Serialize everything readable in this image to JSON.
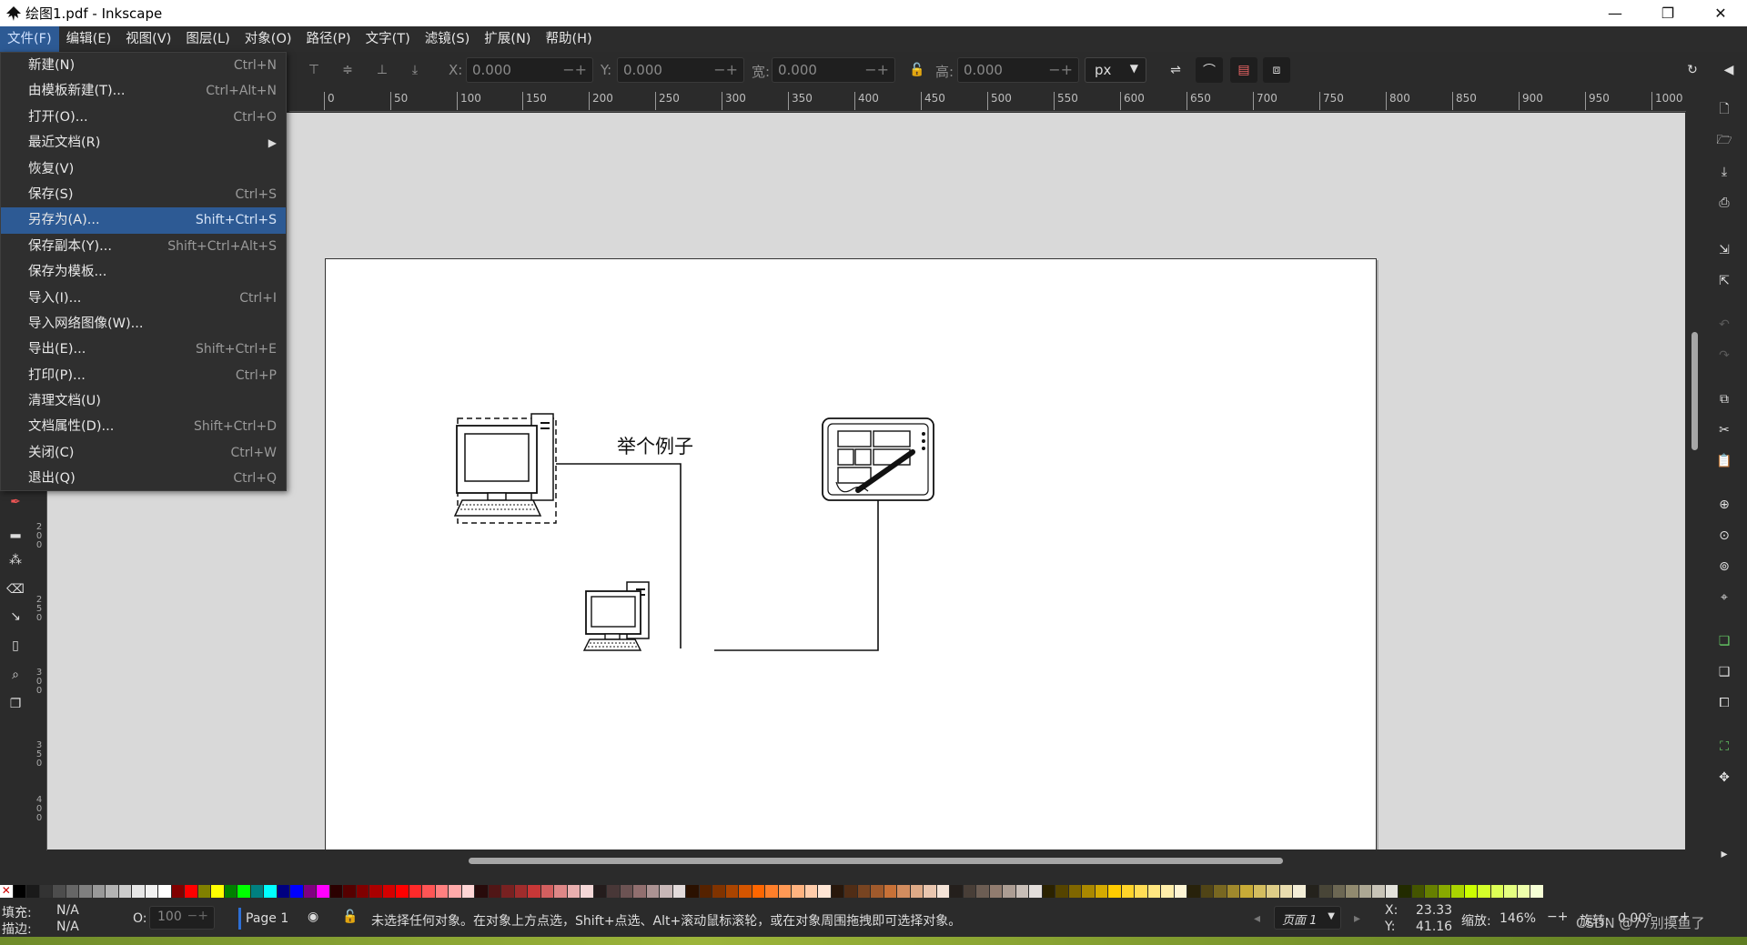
{
  "window": {
    "title": "绘图1.pdf - Inkscape",
    "minimize": "—",
    "maximize": "❐",
    "close": "✕"
  },
  "menubar": [
    "文件(F)",
    "编辑(E)",
    "视图(V)",
    "图层(L)",
    "对象(O)",
    "路径(P)",
    "文字(T)",
    "滤镜(S)",
    "扩展(N)",
    "帮助(H)"
  ],
  "file_menu": [
    {
      "label": "新建(N)",
      "shortcut": "Ctrl+N"
    },
    {
      "label": "由模板新建(T)...",
      "shortcut": "Ctrl+Alt+N"
    },
    {
      "label": "打开(O)...",
      "shortcut": "Ctrl+O"
    },
    {
      "label": "最近文档(R)",
      "shortcut": ""
    },
    {
      "label": "恢复(V)",
      "shortcut": ""
    },
    {
      "label": "保存(S)",
      "shortcut": "Ctrl+S"
    },
    {
      "label": "另存为(A)...",
      "shortcut": "Shift+Ctrl+S"
    },
    {
      "label": "保存副本(Y)...",
      "shortcut": "Shift+Ctrl+Alt+S"
    },
    {
      "label": "保存为模板...",
      "shortcut": ""
    },
    {
      "label": "导入(I)...",
      "shortcut": "Ctrl+I"
    },
    {
      "label": "导入网络图像(W)...",
      "shortcut": ""
    },
    {
      "label": "导出(E)...",
      "shortcut": "Shift+Ctrl+E"
    },
    {
      "label": "打印(P)...",
      "shortcut": "Ctrl+P"
    },
    {
      "label": "清理文档(U)",
      "shortcut": ""
    },
    {
      "label": "文档属性(D)...",
      "shortcut": "Shift+Ctrl+D"
    },
    {
      "label": "关闭(C)",
      "shortcut": "Ctrl+W"
    },
    {
      "label": "退出(Q)",
      "shortcut": "Ctrl+Q"
    }
  ],
  "toolbar": {
    "x_label": "X:",
    "x_value": "0.000",
    "y_label": "Y:",
    "y_value": "0.000",
    "w_label": "宽:",
    "w_value": "0.000",
    "h_label": "高:",
    "h_value": "0.000",
    "unit": "px",
    "pm": "−+"
  },
  "ruler": [
    "0",
    "50",
    "100",
    "150",
    "200",
    "250",
    "300",
    "350",
    "400",
    "450",
    "500",
    "550",
    "600",
    "650",
    "700",
    "750",
    "800",
    "850",
    "900",
    "950",
    "1000"
  ],
  "vruler": [
    "2",
    "0",
    "0",
    "2",
    "5",
    "0",
    "3",
    "0",
    "0",
    "3",
    "5",
    "0",
    "4",
    "0",
    "0"
  ],
  "drawing": {
    "label": "举个例子"
  },
  "status": {
    "fill_label": "填充:",
    "fill_value": "N/A",
    "stroke_label": "描边:",
    "stroke_value": "N/A",
    "opacity_label": "O:",
    "opacity_value": "100",
    "layer": "Page 1",
    "message": "未选择任何对象。在对象上方点选，Shift+点选、Alt+滚动鼠标滚轮，或在对象周围拖拽即可选择对象。",
    "page_select": "页面 1",
    "x_label": "X:",
    "x_value": "23.33",
    "y_label": "Y:",
    "y_value": "41.16",
    "zoom_label": "缩放:",
    "zoom_value": "146%",
    "rotate_label": "旋转:",
    "rotate_value": "0.00°",
    "watermark": "CSDN @77别摸鱼了"
  },
  "colors": {
    "accent": "#2d5a94"
  },
  "palette": [
    "#000000",
    "#1a1a1a",
    "#333333",
    "#4d4d4d",
    "#666666",
    "#808080",
    "#999999",
    "#b3b3b3",
    "#cccccc",
    "#e6e6e6",
    "#f2f2f2",
    "#ffffff",
    "#800000",
    "#ff0000",
    "#808000",
    "#ffff00",
    "#008000",
    "#00ff00",
    "#008080",
    "#00ffff",
    "#000080",
    "#0000ff",
    "#800080",
    "#ff00ff",
    "#2b0000",
    "#550000",
    "#800000",
    "#aa0000",
    "#d40000",
    "#ff0000",
    "#ff2a2a",
    "#ff5555",
    "#ff8080",
    "#ffaaaa",
    "#ffd5d5",
    "#280b0b",
    "#501616",
    "#782121",
    "#a02c2c",
    "#c83737",
    "#d35f5f",
    "#de8787",
    "#e9afaf",
    "#f4d7d7",
    "#241c1c",
    "#483737",
    "#6c5353",
    "#916f6f",
    "#ac9393",
    "#c8b7b7",
    "#e3dbdb",
    "#2b1100",
    "#552200",
    "#803300",
    "#aa4400",
    "#d45500",
    "#ff6600",
    "#ff7f2a",
    "#ff9955",
    "#ffb380",
    "#ffccaa",
    "#ffe6d5",
    "#28170b",
    "#502d16",
    "#784421",
    "#a05a2c",
    "#c87137",
    "#d38d5f",
    "#deaa87",
    "#e9c6af",
    "#f4e3d7",
    "#241f1c",
    "#483e37",
    "#6c5d53",
    "#917c6f",
    "#ac9d93",
    "#c8beb7",
    "#e3dedb",
    "#2b2200",
    "#554400",
    "#806600",
    "#aa8800",
    "#d4aa00",
    "#ffcc00",
    "#ffd42a",
    "#ffdd55",
    "#ffe680",
    "#ffeeaa",
    "#fff6d5",
    "#28220b",
    "#504416",
    "#786721",
    "#a0892c",
    "#c8ab37",
    "#d4bd5f",
    "#decd87",
    "#e9ddaf",
    "#f4eed7",
    "#24221c",
    "#484537",
    "#6c6753",
    "#918a6f",
    "#aca793",
    "#c8c4b7",
    "#e3e2db",
    "#222b00",
    "#445500",
    "#668000",
    "#88aa00",
    "#aad400",
    "#ccff00",
    "#d4ff2a",
    "#ddff55",
    "#e5ff80",
    "#eeffaa",
    "#f6ffd5"
  ],
  "icons": {
    "app": "inkscape-logo-icon",
    "snap": "snap-icon",
    "new_doc": "new-document-icon",
    "open": "open-folder-icon",
    "save": "save-icon",
    "print": "print-icon",
    "import": "import-icon",
    "export": "export-icon",
    "undo": "undo-icon",
    "redo": "redo-icon",
    "copy": "copy-icon",
    "cut": "cut-icon",
    "paste": "paste-icon",
    "zoom_sel": "zoom-selection-icon",
    "zoom_draw": "zoom-drawing-icon",
    "zoom_page": "zoom-page-icon",
    "zoom_center": "zoom-center-icon",
    "duplicate": "duplicate-icon",
    "clone": "clone-icon",
    "unlink": "unlink-clone-icon",
    "group": "group-icon",
    "ungroup": "ungroup-icon"
  }
}
